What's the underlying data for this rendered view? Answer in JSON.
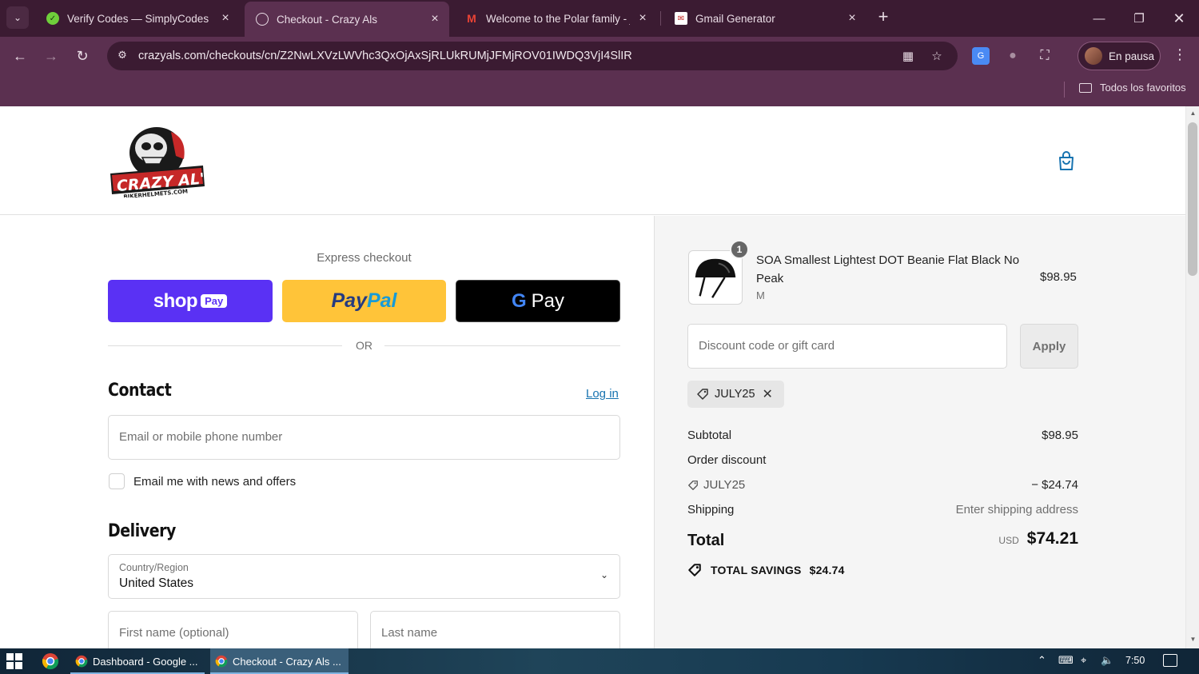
{
  "browser": {
    "tabs": [
      {
        "title": "Verify Codes — SimplyCodes",
        "favicon": "simplycodes-icon"
      },
      {
        "title": "Checkout - Crazy Als",
        "favicon": "globe-icon"
      },
      {
        "title": "Welcome to the Polar family - jc",
        "favicon": "gmail-icon"
      },
      {
        "title": "Gmail Generator",
        "favicon": "gmail-generator-icon"
      }
    ],
    "url": "crazyals.com/checkouts/cn/Z2NwLXVzLWVhc3QxOjAxSjRLUkRUMjJFMjROV01IWDQ3VjI4SlIR",
    "profile_label": "En pausa",
    "bookmarks_all": "Todos los favoritos"
  },
  "checkout": {
    "express_title": "Express checkout",
    "shop_pay_word": "shop",
    "shop_pay_chip": "Pay",
    "paypal_part1": "Pay",
    "paypal_part2": "Pal",
    "gpay_g": "G",
    "gpay_pay": "Pay",
    "or_text": "OR",
    "contact": {
      "title": "Contact",
      "login_link": "Log in",
      "email_placeholder": "Email or mobile phone number",
      "newsletter_label": "Email me with news and offers"
    },
    "delivery": {
      "title": "Delivery",
      "country_label": "Country/Region",
      "country_value": "United States",
      "first_name_placeholder": "First name (optional)",
      "last_name_placeholder": "Last name"
    }
  },
  "summary": {
    "product": {
      "quantity": "1",
      "name": "SOA Smallest Lightest DOT Beanie Flat Black No Peak",
      "variant": "M",
      "price": "$98.95"
    },
    "discount_placeholder": "Discount code or gift card",
    "apply_label": "Apply",
    "applied_code": "JULY25",
    "subtotal_label": "Subtotal",
    "subtotal_value": "$98.95",
    "order_discount_label": "Order discount",
    "discount_code": "JULY25",
    "discount_value": "− $24.74",
    "shipping_label": "Shipping",
    "shipping_value": "Enter shipping address",
    "total_label": "Total",
    "total_currency": "USD",
    "total_value": "$74.21",
    "savings_label": "TOTAL SAVINGS",
    "savings_value": "$24.74"
  },
  "taskbar": {
    "items": [
      {
        "label": "Dashboard - Google ..."
      },
      {
        "label": "Checkout - Crazy Als ..."
      }
    ],
    "clock": "7:50"
  },
  "colors": {
    "shop_pay": "#5a31f4",
    "paypal": "#ffc439",
    "link": "#1773b0",
    "browser_frame": "#5b3050"
  }
}
